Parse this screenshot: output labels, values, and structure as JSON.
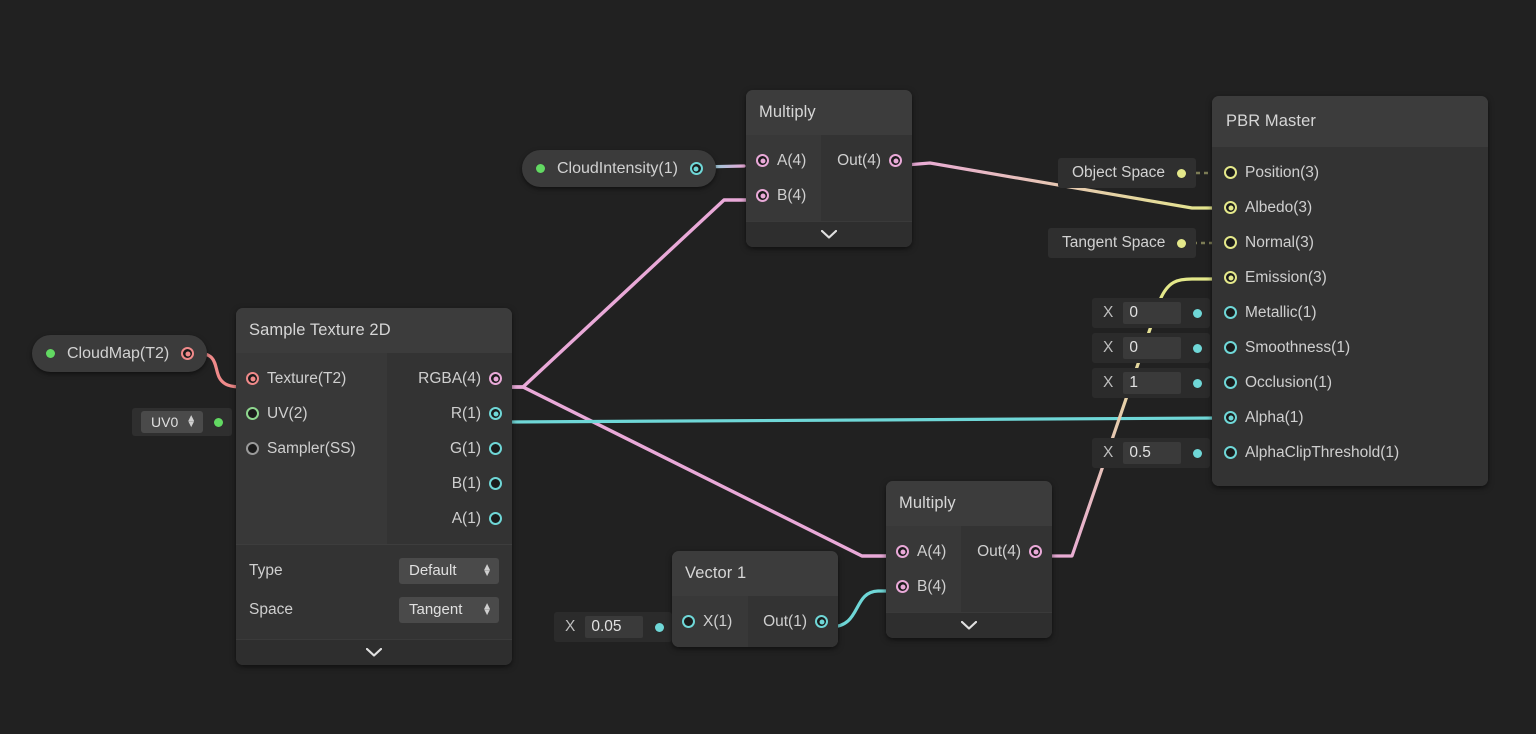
{
  "canvas": {
    "background": "#212121",
    "app": "Shader Graph"
  },
  "colors": {
    "vector1": "#6fd7d7",
    "vector2": "#62d962",
    "vector3": "#e4e88a",
    "vector4": "#e9a9d8",
    "texture": "#f08a8a",
    "node_bg": "#333333",
    "node_header": "#3c3c3c"
  },
  "properties": [
    {
      "name": "cloudmap-property",
      "label": "CloudMap(T2)",
      "port_type": "texture"
    },
    {
      "name": "cloudintensity-property",
      "label": "CloudIntensity(1)",
      "port_type": "vector1"
    }
  ],
  "uv_input": {
    "value": "UV0",
    "arrows": "updown-arrows-icon"
  },
  "nodes": {
    "sample_texture": {
      "title": "Sample Texture 2D",
      "inputs": [
        {
          "label": "Texture(T2)",
          "type": "texture",
          "connected": true
        },
        {
          "label": "UV(2)",
          "type": "vector2",
          "connected": true
        },
        {
          "label": "Sampler(SS)",
          "type": "sampler",
          "connected": false
        }
      ],
      "outputs": [
        {
          "label": "RGBA(4)",
          "type": "vector4",
          "connected": true
        },
        {
          "label": "R(1)",
          "type": "vector1",
          "connected": true
        },
        {
          "label": "G(1)",
          "type": "vector1",
          "connected": false
        },
        {
          "label": "B(1)",
          "type": "vector1",
          "connected": false
        },
        {
          "label": "A(1)",
          "type": "vector1",
          "connected": false
        }
      ],
      "settings": [
        {
          "name": "Type",
          "value": "Default"
        },
        {
          "name": "Space",
          "value": "Tangent"
        }
      ],
      "collapse_icon": "chevron-down-icon"
    },
    "multiply_top": {
      "title": "Multiply",
      "inputs": [
        {
          "label": "A(4)",
          "type": "vector4",
          "connected": true
        },
        {
          "label": "B(4)",
          "type": "vector4",
          "connected": true
        }
      ],
      "outputs": [
        {
          "label": "Out(4)",
          "type": "vector4",
          "connected": true
        }
      ],
      "collapse_icon": "chevron-down-icon"
    },
    "multiply_bottom": {
      "title": "Multiply",
      "inputs": [
        {
          "label": "A(4)",
          "type": "vector4",
          "connected": true
        },
        {
          "label": "B(4)",
          "type": "vector4",
          "connected": true
        }
      ],
      "outputs": [
        {
          "label": "Out(4)",
          "type": "vector4",
          "connected": true
        }
      ],
      "collapse_icon": "chevron-down-icon"
    },
    "vector1": {
      "title": "Vector 1",
      "inputs": [
        {
          "label": "X(1)",
          "type": "vector1",
          "connected": true
        }
      ],
      "outputs": [
        {
          "label": "Out(1)",
          "type": "vector1",
          "connected": true
        }
      ],
      "x_field": {
        "axis": "X",
        "value": "0.05"
      }
    },
    "pbr_master": {
      "title": "PBR Master",
      "slots": [
        {
          "label": "Position(3)",
          "type": "vector3",
          "connected": false
        },
        {
          "label": "Albedo(3)",
          "type": "vector3",
          "connected": true
        },
        {
          "label": "Normal(3)",
          "type": "vector3",
          "connected": false
        },
        {
          "label": "Emission(3)",
          "type": "vector3",
          "connected": true
        },
        {
          "label": "Metallic(1)",
          "type": "vector1",
          "connected": false
        },
        {
          "label": "Smoothness(1)",
          "type": "vector1",
          "connected": false
        },
        {
          "label": "Occlusion(1)",
          "type": "vector1",
          "connected": false
        },
        {
          "label": "Alpha(1)",
          "type": "vector1",
          "connected": true
        },
        {
          "label": "AlphaClipThreshold(1)",
          "type": "vector1",
          "connected": false
        }
      ]
    }
  },
  "inline_inputs": {
    "position_space": {
      "label": "Object Space"
    },
    "normal_space": {
      "label": "Tangent Space"
    },
    "metallic": {
      "axis": "X",
      "value": "0"
    },
    "smoothness": {
      "axis": "X",
      "value": "0"
    },
    "occlusion": {
      "axis": "X",
      "value": "1"
    },
    "alpha_clip": {
      "axis": "X",
      "value": "0.5"
    }
  },
  "connections": [
    {
      "from": "CloudMap(T2)",
      "to": "Sample Texture 2D / Texture(T2)",
      "color": "#f08a8a"
    },
    {
      "from": "UV0",
      "to": "Sample Texture 2D / UV(2)",
      "color": "#62d962"
    },
    {
      "from": "CloudIntensity(1)",
      "to": "Multiply (top) / A(4)",
      "color": "#6fd7d7"
    },
    {
      "from": "Sample Texture 2D / RGBA(4)",
      "to": "Multiply (top) / B(4)",
      "color": "#e9a9d8"
    },
    {
      "from": "Sample Texture 2D / RGBA(4)",
      "to": "Multiply (bottom) / A(4)",
      "color": "#e9a9d8"
    },
    {
      "from": "Sample Texture 2D / R(1)",
      "to": "PBR Master / Alpha(1)",
      "color": "#6fd7d7"
    },
    {
      "from": "Multiply (top) / Out(4)",
      "to": "PBR Master / Albedo(3)",
      "color": "#e9a9d8"
    },
    {
      "from": "Vector 1 / Out(1)",
      "to": "Multiply (bottom) / B(4)",
      "color": "#6fd7d7"
    },
    {
      "from": "Multiply (bottom) / Out(4)",
      "to": "PBR Master / Emission(3)",
      "color": "#e9a9d8"
    }
  ]
}
